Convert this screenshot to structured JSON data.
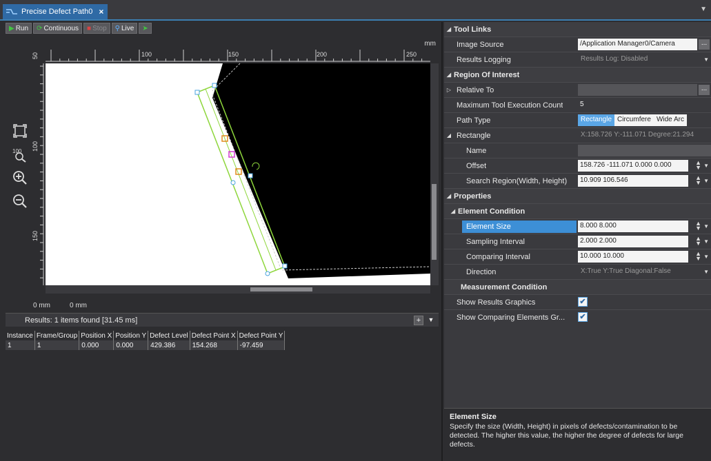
{
  "tab": {
    "title": "Precise Defect Path0",
    "close": "×"
  },
  "toolbar": {
    "run": "Run",
    "continuous": "Continuous",
    "stop": "Stop",
    "live": "Live"
  },
  "image": {
    "unit": "mm",
    "ruler_top": [
      "100",
      "150",
      "200",
      "250"
    ],
    "ruler_left": [
      "50",
      "100",
      "150"
    ],
    "status_x": "0 mm",
    "status_y": "0 mm"
  },
  "results": {
    "summary": "Results: 1 items found [31.45 ms]",
    "columns": [
      "Instance",
      "Frame/Group",
      "Position X",
      "Position Y",
      "Defect Level",
      "Defect Point X",
      "Defect Point Y"
    ],
    "rows": [
      [
        "1",
        "1",
        "0.000",
        "0.000",
        "429.386",
        "154.268",
        "-97.459"
      ]
    ]
  },
  "props": {
    "tool_links": "Tool Links",
    "image_source_label": "Image Source",
    "image_source_value": "/Application Manager0/Camera",
    "results_logging_label": "Results Logging",
    "results_logging_value": "Results Log: Disabled",
    "roi": "Region Of Interest",
    "relative_to_label": "Relative To",
    "max_exec_label": "Maximum Tool Execution Count",
    "max_exec_value": "5",
    "path_type_label": "Path Type",
    "path_type_options": [
      "Rectangle",
      "Circumfere",
      "Wide Arc"
    ],
    "rectangle_label": "Rectangle",
    "rectangle_value": "X:158.726 Y:-111.071 Degree:21.294",
    "name_label": "Name",
    "offset_label": "Offset",
    "offset_value": "158.726 -111.071 0.000 0.000",
    "search_region_label": "Search Region(Width, Height)",
    "search_region_value": "10.909 106.546",
    "properties": "Properties",
    "element_condition": "Element Condition",
    "element_size_label": "Element Size",
    "element_size_value": "8.000 8.000",
    "sampling_label": "Sampling Interval",
    "sampling_value": "2.000 2.000",
    "comparing_label": "Comparing Interval",
    "comparing_value": "10.000 10.000",
    "direction_label": "Direction",
    "direction_value": "X:True Y:True Diagonal:False",
    "measurement_condition": "Measurement Condition",
    "show_graphics_label": "Show Results Graphics",
    "show_comparing_label": "Show Comparing Elements Gr..."
  },
  "help": {
    "title": "Element Size",
    "text": "Specify the size (Width, Height) in pixels of defects/contamination to be detected. The higher this value, the higher the degree of defects for large defects."
  },
  "colors": {
    "accent": "#3d8fd6",
    "roi_green": "#8ed63c",
    "defect_orange": "#e08a1e",
    "defect_magenta": "#d43ad4"
  }
}
